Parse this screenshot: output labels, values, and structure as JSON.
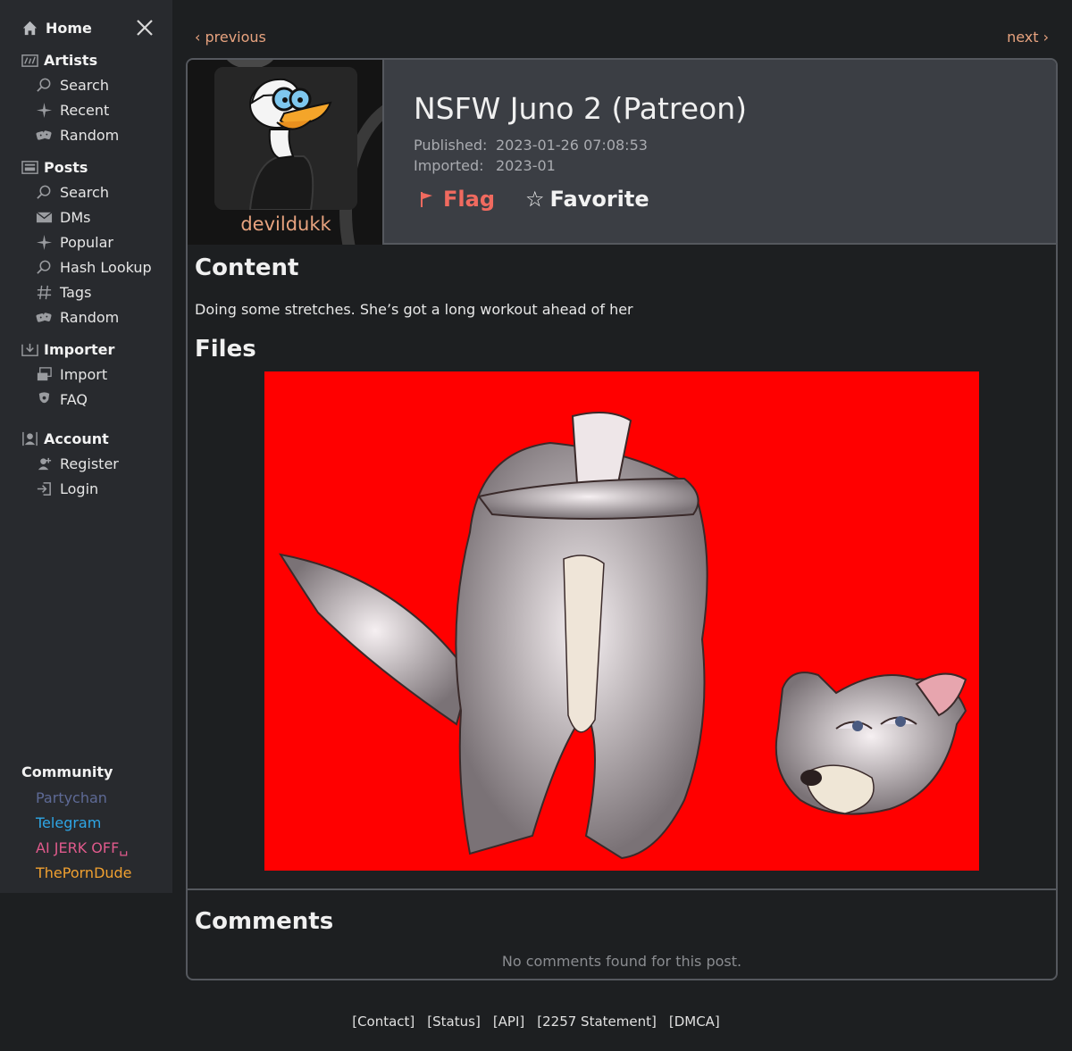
{
  "sidebar": {
    "home_label": "Home",
    "sections": [
      {
        "label": "Artists",
        "icon": "artists-icon",
        "items": [
          {
            "label": "Search",
            "icon": "search-icon"
          },
          {
            "label": "Recent",
            "icon": "sparkle-icon"
          },
          {
            "label": "Random",
            "icon": "dice-icon"
          }
        ]
      },
      {
        "label": "Posts",
        "icon": "posts-icon",
        "items": [
          {
            "label": "Search",
            "icon": "search-icon"
          },
          {
            "label": "DMs",
            "icon": "mail-icon"
          },
          {
            "label": "Popular",
            "icon": "sparkle-icon"
          },
          {
            "label": "Hash Lookup",
            "icon": "search-icon"
          },
          {
            "label": "Tags",
            "icon": "hash-icon"
          },
          {
            "label": "Random",
            "icon": "dice-icon"
          }
        ]
      },
      {
        "label": "Importer",
        "icon": "importer-icon",
        "items": [
          {
            "label": "Import",
            "icon": "import-icon"
          },
          {
            "label": "FAQ",
            "icon": "faq-icon"
          }
        ]
      },
      {
        "label": "Account",
        "icon": "account-icon",
        "items": [
          {
            "label": "Register",
            "icon": "register-icon"
          },
          {
            "label": "Login",
            "icon": "login-icon"
          }
        ]
      }
    ],
    "community": {
      "title": "Community",
      "links": [
        {
          "label": "Partychan",
          "color": "#5e6a96"
        },
        {
          "label": "Telegram",
          "color": "#2ea6e6"
        },
        {
          "label": "AI JERK OFF␣",
          "color": "#e05a8c"
        },
        {
          "label": "ThePornDude",
          "color": "#f0a030"
        }
      ]
    }
  },
  "nav": {
    "previous": "‹ previous",
    "next": "next ›"
  },
  "post": {
    "artist": "devildukk",
    "title": "NSFW Juno 2 (Patreon)",
    "published_label": "Published:",
    "published_value": "2023-01-26 07:08:53",
    "imported_label": "Imported:",
    "imported_value": "2023-01",
    "flag_label": "Flag",
    "favorite_label": "Favorite",
    "content_heading": "Content",
    "content_text": "Doing some stretches. She’s got a long workout ahead of her",
    "files_heading": "Files",
    "comments_heading": "Comments",
    "no_comments": "No comments found for this post."
  },
  "footer": [
    "[Contact]",
    "[Status]",
    "[API]",
    "[2257 Statement]",
    "[DMCA]"
  ],
  "colors": {
    "accent": "#e8a37f",
    "flag": "#f06a5f",
    "file_bg": "#ff0000"
  }
}
